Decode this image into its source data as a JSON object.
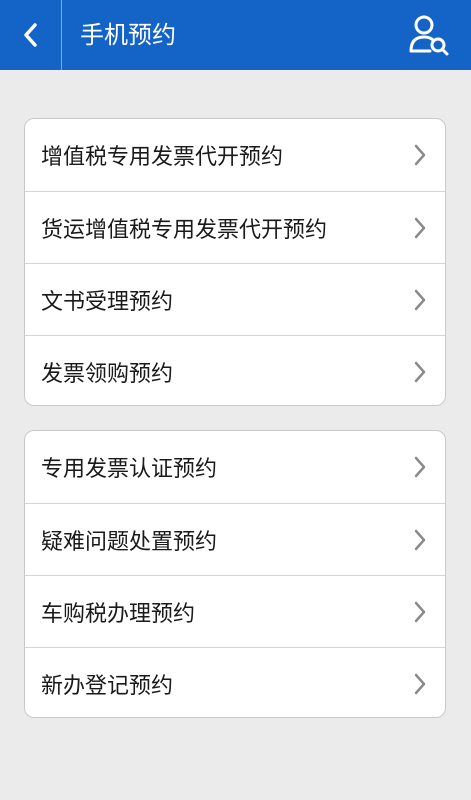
{
  "header": {
    "title": "手机预约",
    "back_icon": "chevron-left-icon",
    "action_icon": "user-search-icon",
    "background": "#1464c8"
  },
  "groups": [
    {
      "items": [
        {
          "label": "增值税专用发票代开预约"
        },
        {
          "label": "货运增值税专用发票代开预约"
        },
        {
          "label": "文书受理预约"
        },
        {
          "label": "发票领购预约"
        }
      ]
    },
    {
      "items": [
        {
          "label": "专用发票认证预约"
        },
        {
          "label": "疑难问题处置预约"
        },
        {
          "label": "车购税办理预约"
        },
        {
          "label": "新办登记预约"
        }
      ]
    }
  ]
}
